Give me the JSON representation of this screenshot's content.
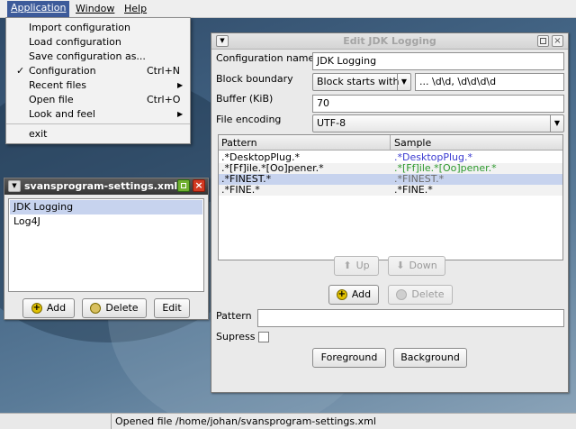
{
  "menubar": {
    "items": [
      "Application",
      "Window",
      "Help"
    ]
  },
  "app_menu": {
    "items": [
      {
        "label": "Import configuration",
        "accel": "",
        "submenu": false,
        "checked": false
      },
      {
        "label": "Load configuration",
        "accel": "",
        "submenu": false,
        "checked": false
      },
      {
        "label": "Save configuration as...",
        "accel": "",
        "submenu": false,
        "checked": false
      },
      {
        "label": "Configuration",
        "accel": "Ctrl+N",
        "submenu": false,
        "checked": true
      },
      {
        "label": "Recent files",
        "accel": "",
        "submenu": true,
        "checked": false
      },
      {
        "label": "Open file",
        "accel": "Ctrl+O",
        "submenu": false,
        "checked": false
      },
      {
        "label": "Look and feel",
        "accel": "",
        "submenu": true,
        "checked": false
      },
      {
        "label": "exit",
        "accel": "",
        "submenu": false,
        "checked": false
      }
    ],
    "check_mark": "✓",
    "submenu_arrow": "▶"
  },
  "settings_frame": {
    "title": "svansprogram-settings.xml",
    "list": [
      "JDK Logging",
      "Log4J"
    ],
    "selected_index": 0,
    "add_label": "Add",
    "delete_label": "Delete",
    "edit_label": "Edit"
  },
  "edit_frame": {
    "title": "Edit JDK Logging",
    "config_name_label": "Configuration name",
    "config_name_value": "JDK Logging",
    "block_boundary_label": "Block boundary",
    "block_boundary_select": "Block starts with",
    "block_boundary_value": "... \\d\\d, \\d\\d\\d\\d",
    "buffer_label": "Buffer (KiB)",
    "buffer_value": "70",
    "encoding_label": "File encoding",
    "encoding_value": "UTF-8",
    "table": {
      "headers": [
        "Pattern",
        "Sample"
      ],
      "rows": [
        {
          "pattern": ".*DesktopPlug.*",
          "sample": ".*DesktopPlug.*",
          "sample_color": "#3a3ad0",
          "selected": false
        },
        {
          "pattern": ".*[Ff]ile.*[Oo]pener.*",
          "sample": ".*[Ff]ile.*[Oo]pener.*",
          "sample_color": "#2e9a2e",
          "selected": false
        },
        {
          "pattern": ".*FINEST.*",
          "sample": ".*FINEST.*",
          "sample_color": "#6a6a6a",
          "selected": true
        },
        {
          "pattern": ".*FINE.*",
          "sample": ".*FINE.*",
          "sample_color": "#000000",
          "selected": false
        }
      ]
    },
    "up_label": "Up",
    "down_label": "Down",
    "add_label": "Add",
    "delete_label": "Delete",
    "pattern_label": "Pattern",
    "pattern_value": "",
    "supress_label": "Supress",
    "foreground_label": "Foreground",
    "background_label": "Background"
  },
  "status": {
    "text": "Opened file /home/johan/svansprogram-settings.xml"
  },
  "colors": {
    "menu_highlight": "#3d5b9a",
    "selection": "#c7d3ee",
    "add_icon": "#e0c000",
    "delete_icon": "#d8c060"
  }
}
